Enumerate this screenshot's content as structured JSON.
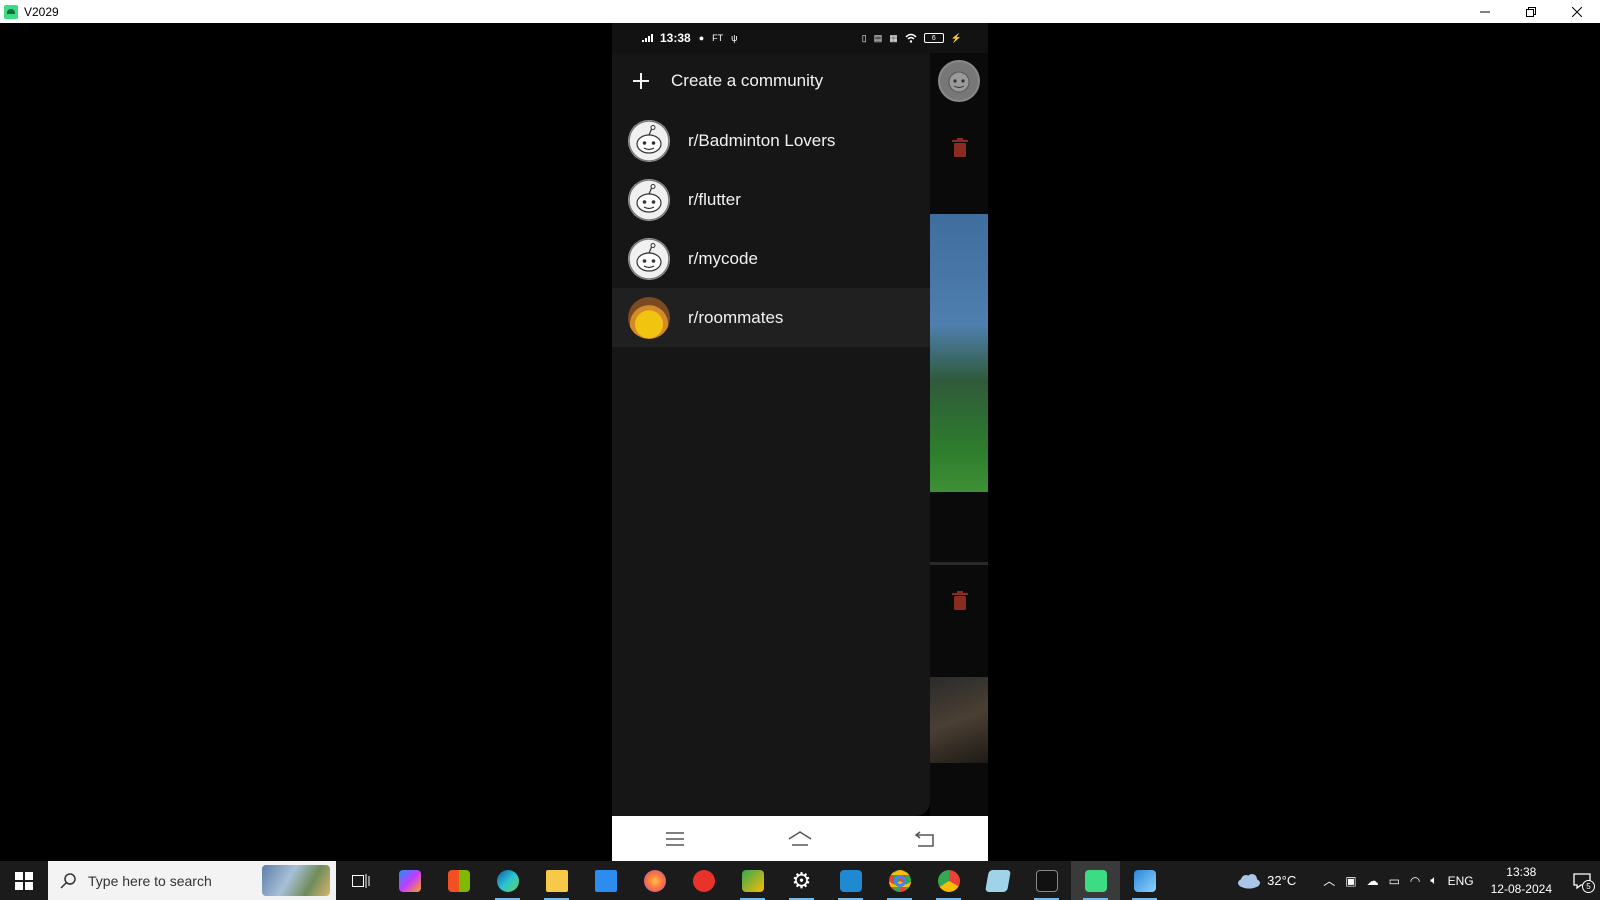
{
  "window": {
    "title": "V2029"
  },
  "phone": {
    "status": {
      "time": "13:38",
      "extra": "FT",
      "battery": "6"
    },
    "drawer": {
      "create_label": "Create a community",
      "communities": [
        {
          "name": "r/Badminton Lovers",
          "avatar": "default-snoo"
        },
        {
          "name": "r/flutter",
          "avatar": "default-snoo"
        },
        {
          "name": "r/mycode",
          "avatar": "default-snoo"
        },
        {
          "name": "r/roommates",
          "avatar": "photo"
        }
      ],
      "selected_index": 3
    },
    "nav": {
      "icons": [
        "menu-icon",
        "home-icon",
        "back-icon"
      ]
    }
  },
  "taskbar": {
    "search_placeholder": "Type here to search",
    "weather": "32°C",
    "language": "ENG",
    "time": "13:38",
    "date": "12-08-2024",
    "notifications": "5"
  }
}
